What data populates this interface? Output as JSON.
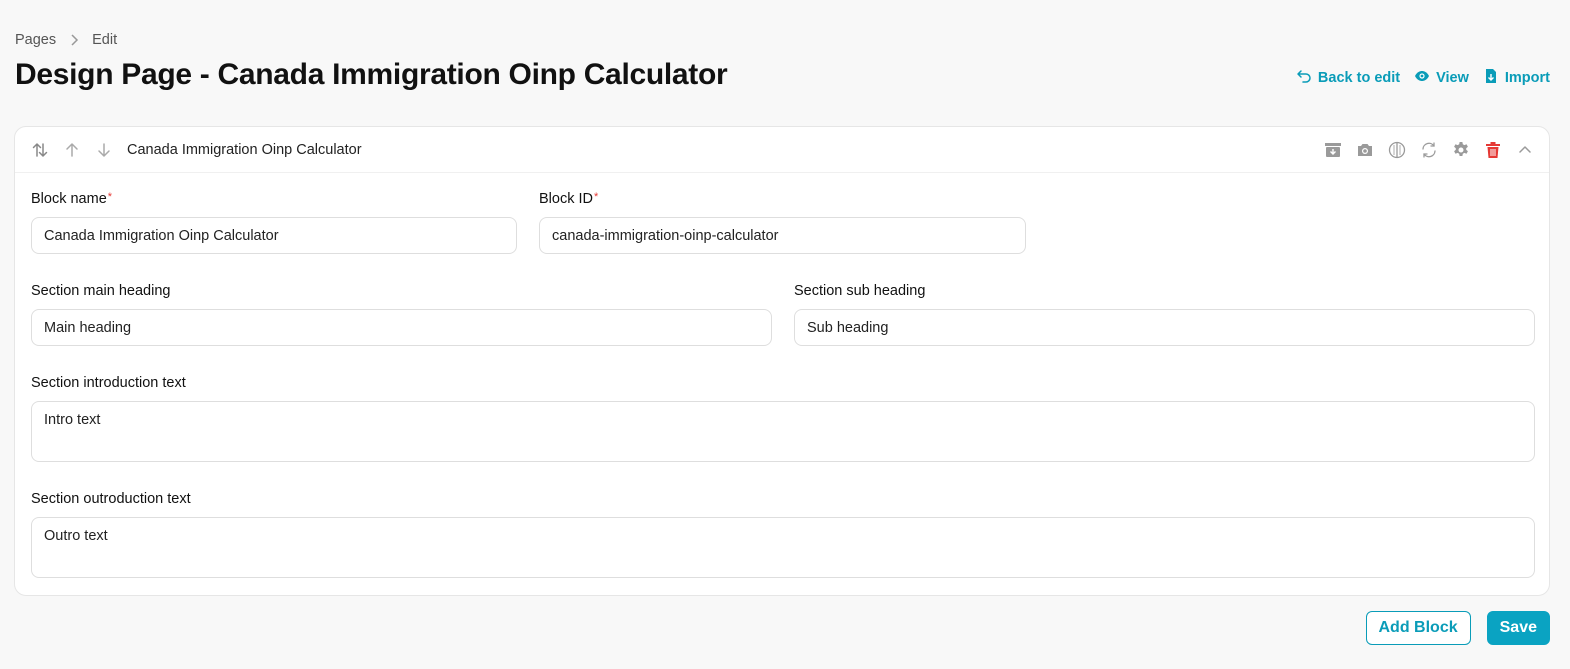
{
  "breadcrumb": [
    {
      "label": "Pages"
    },
    {
      "label": "Edit"
    }
  ],
  "page_title": "Design Page - Canada Immigration Oinp Calculator",
  "header_actions": [
    {
      "label": "Back to edit",
      "icon": "undo-arrow-icon"
    },
    {
      "label": "View",
      "icon": "eye-icon"
    },
    {
      "label": "Import",
      "icon": "file-import-icon"
    }
  ],
  "block": {
    "title": "Canada Immigration Oinp Calculator",
    "reorder_icons": [
      "swap-vertical-icon",
      "arrow-up-icon",
      "arrow-down-icon"
    ],
    "tools": [
      "archive-icon",
      "camera-icon",
      "contrast-icon",
      "refresh-icon",
      "gear-icon",
      "trash-icon",
      "chevron-up-icon"
    ],
    "fields": {
      "block_name": {
        "label": "Block name",
        "required_mark": "*",
        "value": "Canada Immigration Oinp Calculator"
      },
      "block_id": {
        "label": "Block ID",
        "required_mark": "*",
        "value": "canada-immigration-oinp-calculator"
      },
      "main_heading": {
        "label": "Section main heading",
        "value": "Main heading"
      },
      "sub_heading": {
        "label": "Section sub heading",
        "value": "Sub heading"
      },
      "intro_text": {
        "label": "Section introduction text",
        "value": "Intro text"
      },
      "outro_text": {
        "label": "Section outroduction text",
        "value": "Outro text"
      }
    }
  },
  "footer": {
    "add_block_label": "Add Block",
    "save_label": "Save"
  },
  "colors": {
    "accent": "#0aa3c2",
    "danger": "#e53935",
    "background": "#f8f8f8"
  }
}
